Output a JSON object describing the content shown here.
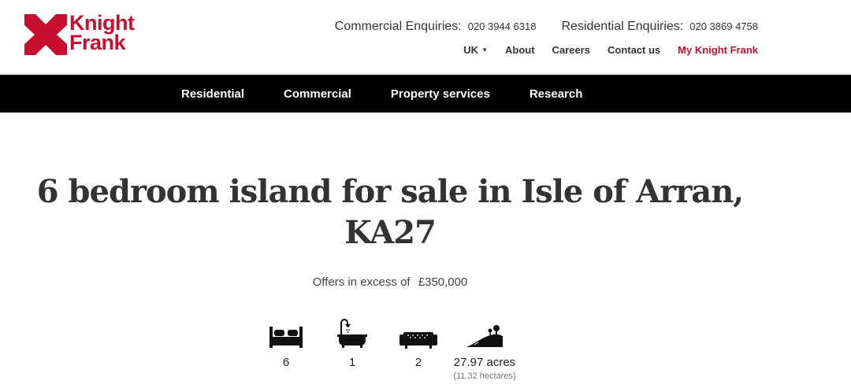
{
  "brand": {
    "line1": "Knight",
    "line2": "Frank",
    "color": "#c8102e"
  },
  "enquiries": {
    "commercial_label": "Commercial Enquiries:",
    "commercial_number": "020 3944 6318",
    "residential_label": "Residential Enquiries:",
    "residential_number": "020 3869 4758"
  },
  "topnav": {
    "region": "UK",
    "about": "About",
    "careers": "Careers",
    "contact": "Contact us",
    "my_account": "My Knight Frank"
  },
  "mainnav": {
    "items": [
      "Residential",
      "Commercial",
      "Property services",
      "Research"
    ]
  },
  "property": {
    "title_line1": "6 bedroom island for sale in Isle of Arran,",
    "title_line2": "KA27",
    "price_qualifier": "Offers in excess of",
    "price": "£350,000"
  },
  "features": [
    {
      "icon": "bed-icon",
      "value": "6"
    },
    {
      "icon": "bath-icon",
      "value": "1"
    },
    {
      "icon": "sofa-icon",
      "value": "2"
    },
    {
      "icon": "land-icon",
      "value": "27.97 acres",
      "sub": "(11.32 hectares)"
    }
  ]
}
